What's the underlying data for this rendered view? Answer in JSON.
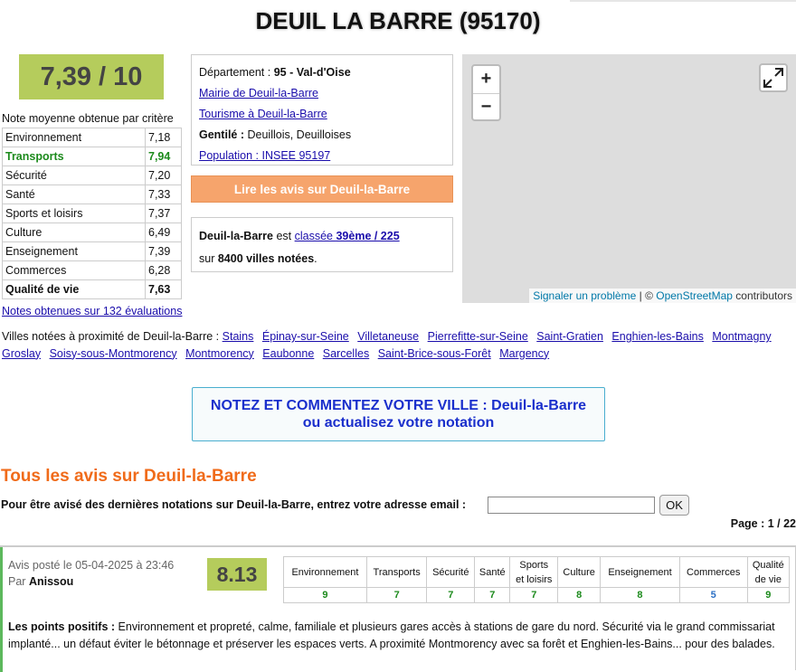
{
  "page": {
    "title": "DEUIL LA BARRE (95170)"
  },
  "score": {
    "value": "7,39 / 10",
    "color": "#b5cc5c"
  },
  "criteria": {
    "title": "Note moyenne obtenue par critère",
    "rows": [
      {
        "label": "Environnement",
        "value": "7,18"
      },
      {
        "label": "Transports",
        "value": "7,94"
      },
      {
        "label": "Sécurité",
        "value": "7,20"
      },
      {
        "label": "Santé",
        "value": "7,33"
      },
      {
        "label": "Sports et loisirs",
        "value": "7,37"
      },
      {
        "label": "Culture",
        "value": "6,49"
      },
      {
        "label": "Enseignement",
        "value": "7,39"
      },
      {
        "label": "Commerces",
        "value": "6,28"
      },
      {
        "label": "Qualité de vie",
        "value": "7,63"
      }
    ],
    "notes_link": "Notes obtenues sur 132 évaluations"
  },
  "info": {
    "departement_label": "Département : ",
    "departement_value": "95 - Val-d'Oise",
    "mairie_link": "Mairie de Deuil-la-Barre",
    "tourisme_link": "Tourisme à Deuil-la-Barre",
    "gentile_label": "Gentilé : ",
    "gentile_value": "Deuillois, Deuilloises",
    "population_link": "Population : INSEE 95197"
  },
  "avis_button": "Lire les avis sur Deuil-la-Barre",
  "rank": {
    "city": "Deuil-la-Barre",
    "text1": " est ",
    "link_prefix": "classée ",
    "link_rank": "39ème / 225",
    "text2": "sur ",
    "count": "8400 villes notées",
    "dot": "."
  },
  "map": {
    "zoom_in": "+",
    "zoom_out": "−",
    "report_link": "Signaler un problème",
    "sep": " | © ",
    "osm_link": "OpenStreetMap",
    "contributors": " contributors"
  },
  "nearby": {
    "label": "Villes notées à proximité de Deuil-la-Barre : ",
    "cities": [
      "Stains",
      "Épinay-sur-Seine",
      "Villetaneuse",
      "Pierrefitte-sur-Seine",
      "Saint-Gratien",
      "Enghien-les-Bains",
      "Montmagny",
      "Groslay",
      "Soisy-sous-Montmorency",
      "Montmorency",
      "Eaubonne",
      "Sarcelles",
      "Saint-Brice-sous-Forêt",
      "Margency"
    ]
  },
  "cta": {
    "line1": "NOTEZ ET COMMENTEZ VOTRE VILLE : Deuil-la-Barre",
    "line2": "ou actualisez votre notation"
  },
  "reviews_section": {
    "title": "Tous les avis sur Deuil-la-Barre",
    "email_label": "Pour être avisé des dernières notations sur Deuil-la-Barre, entrez votre adresse email :",
    "email_value": "",
    "ok": "OK",
    "pager": "Page : 1 / 22"
  },
  "review": {
    "posted": "Avis posté le 05-04-2025 à 23:46",
    "by_label": "Par ",
    "author": "Anissou",
    "score": "8.13",
    "headers": [
      "Environnement",
      "Transports",
      "Sécurité",
      "Santé",
      "Sports\net loisirs",
      "Culture",
      "Enseignement",
      "Commerces",
      "Qualité\nde vie"
    ],
    "values": [
      "9",
      "7",
      "7",
      "7",
      "7",
      "8",
      "8",
      "5",
      "9"
    ],
    "positifs_label": "Les points positifs : ",
    "positifs_text": "Environnement et propreté, calme, familiale et plusieurs gares accès à stations de gare du nord. Sécurité via le grand commissariat implanté... un défaut éviter le bétonnage et préserver les espaces verts. A proximité Montmorency avec sa forêt et Enghien-les-Bains... pour des balades."
  }
}
